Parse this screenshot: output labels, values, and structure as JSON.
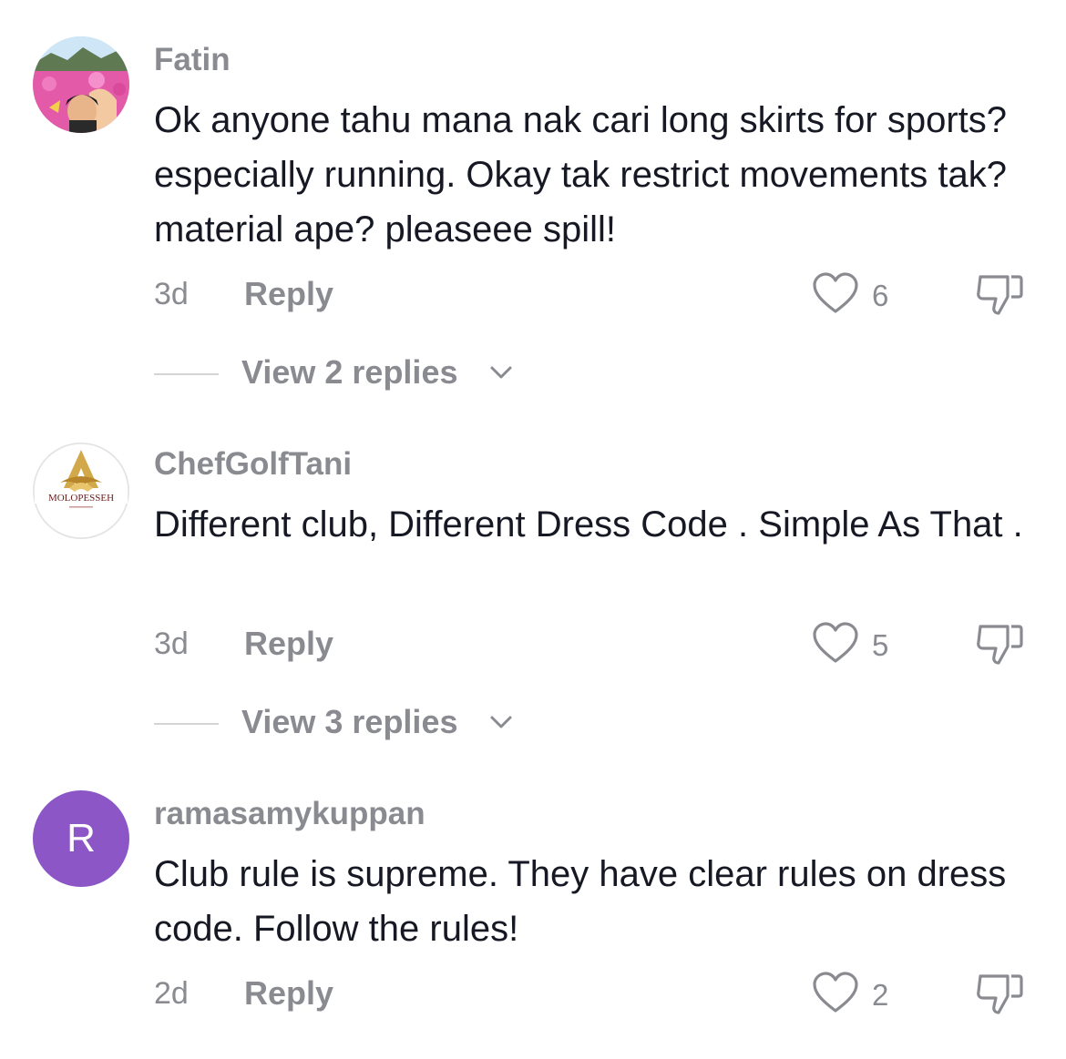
{
  "comments": [
    {
      "username": "Fatin",
      "text": "Ok anyone tahu mana nak cari long skirts for sports? especially running. Okay tak restrict movements tak? material ape? pleaseee spill!",
      "time": "3d",
      "reply_label": "Reply",
      "likes": "6",
      "view_replies": "View 2 replies",
      "avatar_icon": "photo-avatar"
    },
    {
      "username": "ChefGolfTani",
      "text": "Different club, Different Dress Code . Simple As That .",
      "time": "3d",
      "reply_label": "Reply",
      "likes": "5",
      "view_replies": "View 3 replies",
      "avatar_icon": "logo-avatar",
      "avatar_logo_text": "MOLOPESSEH"
    },
    {
      "username": "ramasamykuppan",
      "text": "Club rule is supreme. They have clear rules on dress code. Follow the rules!",
      "time": "2d",
      "reply_label": "Reply",
      "likes": "2",
      "avatar_letter": "R",
      "avatar_color": "#8c56c6"
    }
  ],
  "colors": {
    "text_primary": "#161823",
    "text_secondary": "#8a8b91",
    "divider": "#d5d5d8"
  },
  "icons": [
    "heart-outline-icon",
    "thumbs-down-icon",
    "chevron-down-icon"
  ]
}
